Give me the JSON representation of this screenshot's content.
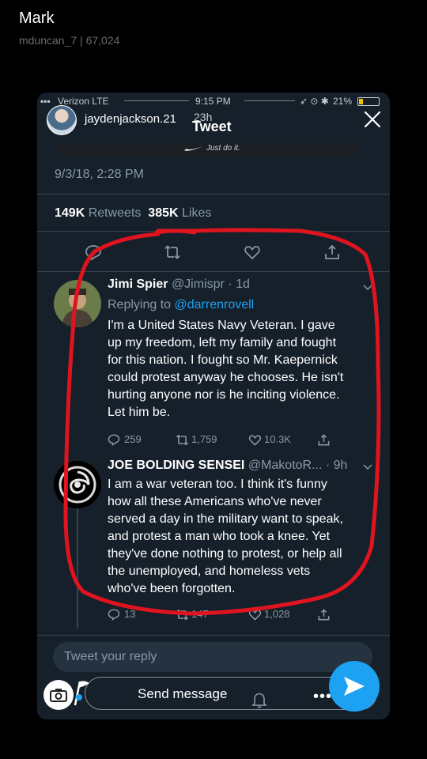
{
  "sender": {
    "name": "Mark",
    "meta": "mduncan_7 | 67,024"
  },
  "status_bar": {
    "carrier": "Verizon  LTE",
    "time": "9:15 PM",
    "battery": "21%"
  },
  "story": {
    "username": "jaydenjackson.21",
    "age": "23h",
    "header_title": "Tweet"
  },
  "tweet": {
    "image_caption": "Just do it.",
    "date": "9/3/18, 2:28 PM",
    "retweets_count": "149K",
    "retweets_label": "Retweets",
    "likes_count": "385K",
    "likes_label": "Likes"
  },
  "replies": [
    {
      "name": "Jimi Spier",
      "handle": "@Jimispr · 1d",
      "replying_prefix": "Replying to",
      "replying_to": "@darrenrovell",
      "lines": [
        "I'm a United States Navy Veteran. I gave",
        "up my freedom, left my family and fought",
        "for this nation. I fought so Mr. Kaepernick",
        "could protest anyway he chooses. He isn't",
        "hurting anyone nor is he inciting violence.",
        "Let him be."
      ],
      "replies_count": "259",
      "retweets_count": "1,759",
      "likes_count": "10.3K"
    },
    {
      "name": "JOE BOLDING SENSEI",
      "handle": "@MakotoR... · 9h",
      "lines": [
        "I am a war veteran too. I think it's funny",
        "how all these Americans who've never",
        "served a day in the military want to speak,",
        "and protest a man who took a knee. Yet",
        "they've done nothing to protest, or help all",
        "the unemployed, and homeless vets",
        "who've been forgotten."
      ],
      "replies_count": "13",
      "retweets_count": "147",
      "likes_count": "1,028"
    }
  ],
  "reply_box": {
    "placeholder": "Tweet your reply"
  },
  "bottom": {
    "send_label": "Send message"
  },
  "colors": {
    "background": "#15202b",
    "accent": "#1da1f2",
    "annotation": "#e0141e",
    "muted": "#8899a6"
  }
}
